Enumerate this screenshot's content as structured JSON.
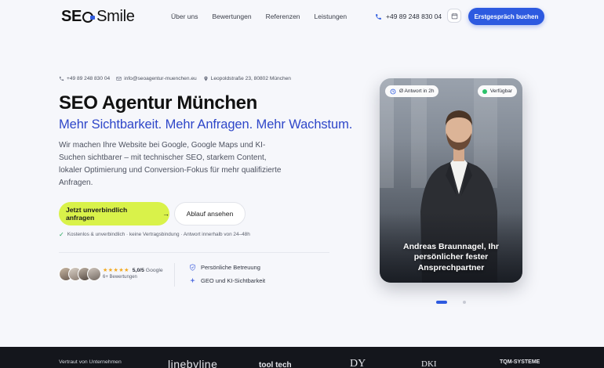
{
  "nav": {
    "logo_part1": "SE",
    "logo_part2": "Smile",
    "menu": [
      "Über uns",
      "Bewertungen",
      "Referenzen",
      "Leistungen"
    ],
    "phone": "+49 89 248 830 04",
    "cta": "Erstgespräch buchen"
  },
  "contact": {
    "phone": "+49 89 248 830 04",
    "email": "info@seoagentur-muenchen.eu",
    "address": "Leopoldstraße 23, 80802 München"
  },
  "hero": {
    "title": "SEO Agentur München",
    "subtitle": "Mehr Sichtbarkeit. Mehr Anfragen. Mehr Wachstum.",
    "description": "Wir machen Ihre Website bei Google, Google Maps und KI-Suchen sichtbarer – mit technischer SEO, starkem Content, lokaler Optimierung und Conversion-Fokus für mehr qualifizierte Anfragen.",
    "primary_button": "Jetzt unverbindlich anfragen",
    "secondary_button": "Ablauf ansehen",
    "note": "Kostenlos & unverbindlich · keine Vertragsbindung · Antwort innerhalb von 24–48h"
  },
  "rating": {
    "stars": "★★★★★",
    "score": "5,0/5",
    "source": "Google",
    "reviews": "6+ Bewertungen"
  },
  "features": [
    "Persönliche Betreuung",
    "GEO und KI-Sichtbarkeit"
  ],
  "card": {
    "badge_response": "Ø Antwort in 2h",
    "badge_available": "Verfügbar",
    "caption": "Andreas Braunnagel, Ihr persönlicher fester Ansprechpartner"
  },
  "trust": {
    "label": "Vertraut von Unternehmen",
    "logos": [
      "linebyline",
      "tool tech",
      "DY",
      "DKI",
      "TQM-SYSTEME"
    ]
  },
  "colors": {
    "accent_blue": "#2d5ae0",
    "lime": "#d9f24a",
    "subtitle_blue": "#2f47c9",
    "footer_dark": "#14161c"
  }
}
